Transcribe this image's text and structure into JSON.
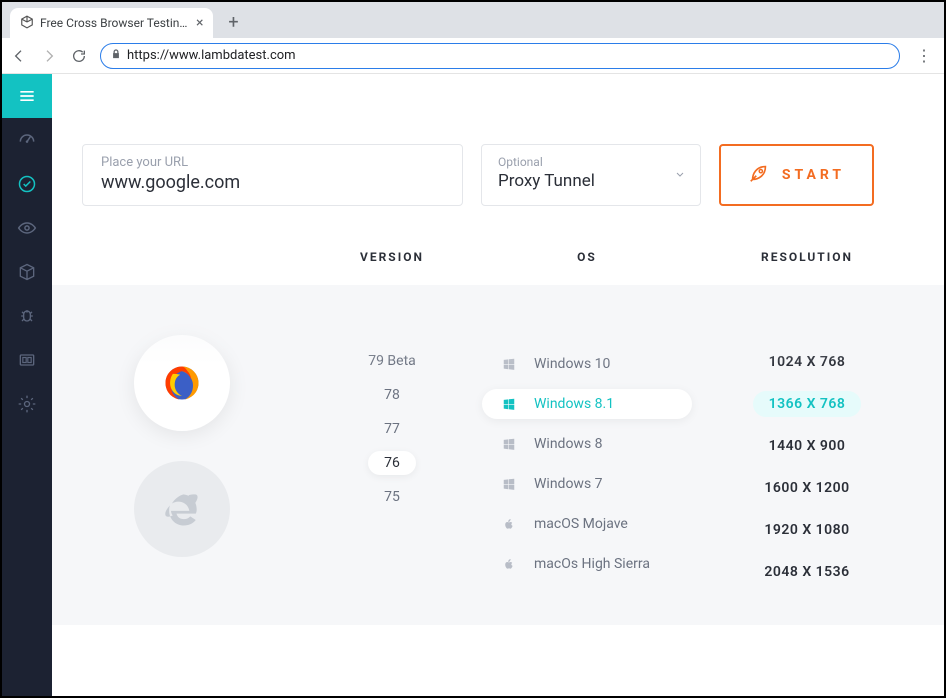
{
  "browser_chrome": {
    "tab_title": "Free Cross Browser Testing Clou",
    "new_tab": "+",
    "close": "×",
    "url": "https://www.lambdatest.com",
    "back": "←",
    "forward": "→",
    "reload": "↻",
    "menu": "⋮"
  },
  "sidebar": {
    "items": [
      {
        "name": "menu",
        "active": false
      },
      {
        "name": "dashboard",
        "active": false
      },
      {
        "name": "realtime",
        "active": true
      },
      {
        "name": "visual",
        "active": false
      },
      {
        "name": "package",
        "active": false
      },
      {
        "name": "bug",
        "active": false
      },
      {
        "name": "integrations",
        "active": false
      },
      {
        "name": "settings",
        "active": false
      }
    ]
  },
  "controls": {
    "url_label": "Place your URL",
    "url_value": "www.google.com",
    "proxy_label": "Optional",
    "proxy_value": "Proxy Tunnel",
    "start_label": "START"
  },
  "headers": {
    "version": "VERSION",
    "os": "OS",
    "resolution": "RESOLUTION"
  },
  "browsers": [
    {
      "name": "firefox",
      "active": true
    },
    {
      "name": "ie",
      "active": false
    }
  ],
  "versions": [
    {
      "label": "79 Beta",
      "selected": false
    },
    {
      "label": "78",
      "selected": false
    },
    {
      "label": "77",
      "selected": false
    },
    {
      "label": "76",
      "selected": true
    },
    {
      "label": "75",
      "selected": false
    }
  ],
  "os_list": [
    {
      "label": "Windows 10",
      "platform": "windows",
      "selected": false
    },
    {
      "label": "Windows 8.1",
      "platform": "windows",
      "selected": true
    },
    {
      "label": "Windows 8",
      "platform": "windows",
      "selected": false
    },
    {
      "label": "Windows 7",
      "platform": "windows",
      "selected": false
    },
    {
      "label": "macOS Mojave",
      "platform": "mac",
      "selected": false
    },
    {
      "label": "macOs High Sierra",
      "platform": "mac",
      "selected": false
    }
  ],
  "resolutions": [
    {
      "label": "1024 X 768",
      "selected": false
    },
    {
      "label": "1366 X 768",
      "selected": true
    },
    {
      "label": "1440 X 900",
      "selected": false
    },
    {
      "label": "1600 X 1200",
      "selected": false
    },
    {
      "label": "1920 X 1080",
      "selected": false
    },
    {
      "label": "2048 X 1536",
      "selected": false
    }
  ]
}
